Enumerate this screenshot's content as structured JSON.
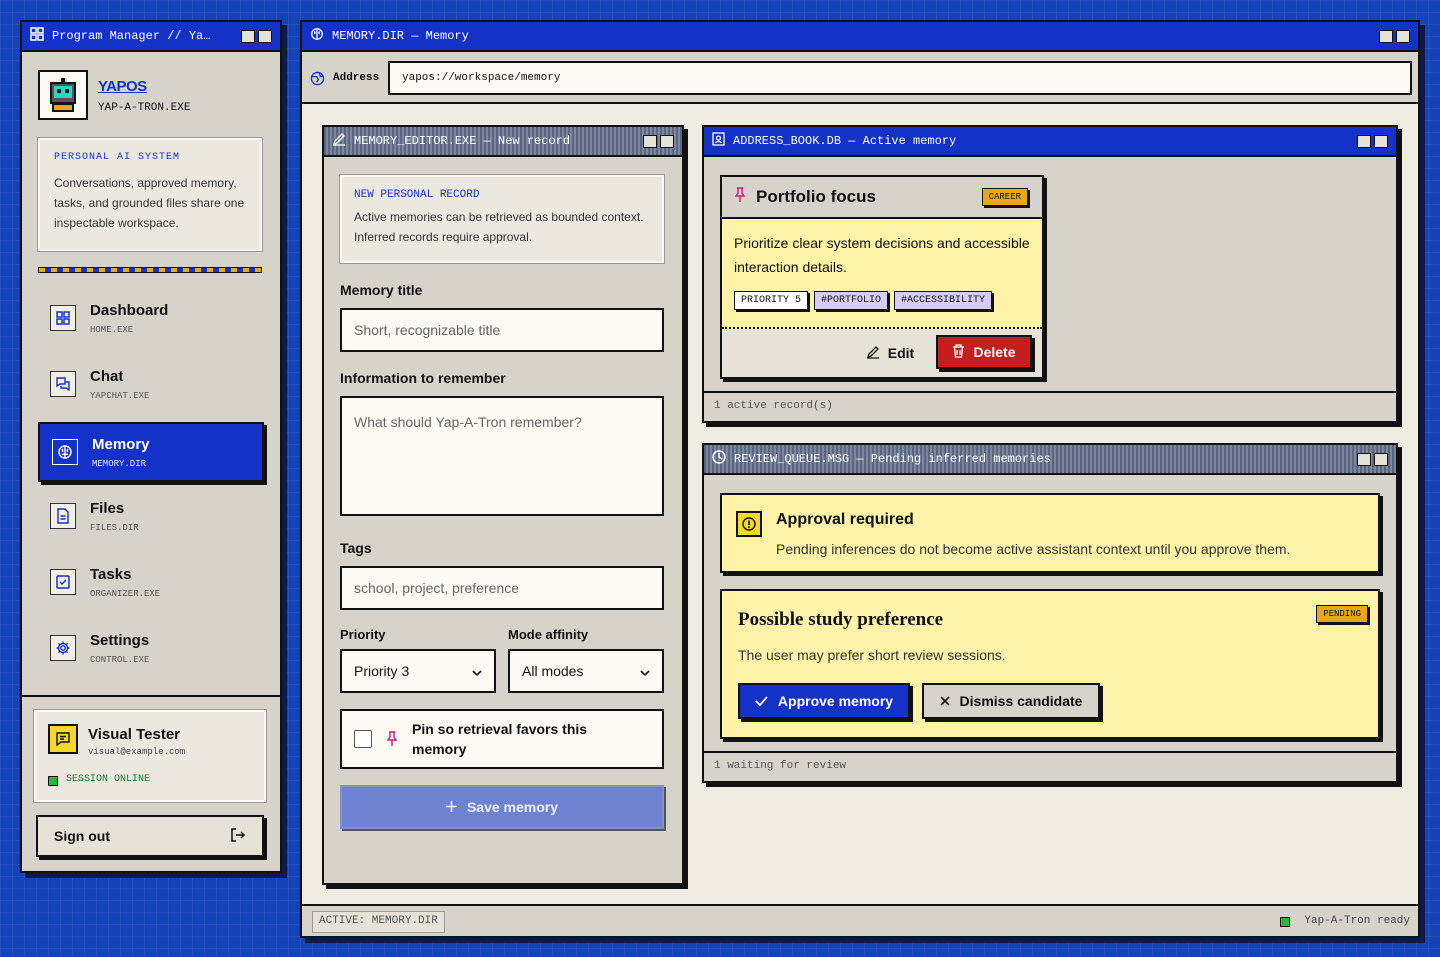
{
  "sidebar": {
    "title": "Program Manager // Ya…",
    "app_name": "YAPOS",
    "app_exe": "YAP-A-TRON.EXE",
    "intro": {
      "heading": "PERSONAL AI SYSTEM",
      "text": "Conversations, approved memory, tasks, and grounded files share one inspectable workspace."
    },
    "nav": [
      {
        "label": "Dashboard",
        "sub": "HOME.EXE"
      },
      {
        "label": "Chat",
        "sub": "YAPCHAT.EXE"
      },
      {
        "label": "Memory",
        "sub": "MEMORY.DIR"
      },
      {
        "label": "Files",
        "sub": "FILES.DIR"
      },
      {
        "label": "Tasks",
        "sub": "ORGANIZER.EXE"
      },
      {
        "label": "Settings",
        "sub": "CONTROL.EXE"
      }
    ],
    "user": {
      "name": "Visual Tester",
      "email": "visual@example.com",
      "status": "SESSION ONLINE"
    },
    "sign_out": "Sign out"
  },
  "main": {
    "title": "MEMORY.DIR — Memory",
    "address_label": "Address",
    "address_value": "yapos://workspace/memory",
    "status_left": "ACTIVE: MEMORY.DIR",
    "status_right": "Yap-A-Tron ready"
  },
  "editor": {
    "title": "MEMORY_EDITOR.EXE — New record",
    "info_heading": "NEW PERSONAL RECORD",
    "info_text": "Active memories can be retrieved as bounded context. Inferred records require approval.",
    "title_label": "Memory title",
    "title_placeholder": "Short, recognizable title",
    "info_label": "Information to remember",
    "info_placeholder": "What should Yap-A-Tron remember?",
    "tags_label": "Tags",
    "tags_placeholder": "school, project, preference",
    "priority_label": "Priority",
    "priority_value": "Priority 3",
    "mode_label": "Mode affinity",
    "mode_value": "All modes",
    "pin_label": "Pin so retrieval favors this memory",
    "save_label": "Save memory"
  },
  "address_book": {
    "title": "ADDRESS_BOOK.DB — Active memory",
    "card": {
      "title": "Portfolio focus",
      "badge": "CAREER",
      "text": "Prioritize clear system decisions and accessible interaction details.",
      "tags": [
        "PRIORITY 5",
        "#PORTFOLIO",
        "#ACCESSIBILITY"
      ],
      "edit": "Edit",
      "delete": "Delete"
    },
    "footer": "1 active record(s)"
  },
  "review": {
    "title": "REVIEW_QUEUE.MSG — Pending inferred memories",
    "notice_title": "Approval required",
    "notice_text": "Pending inferences do not become active assistant context until you approve them.",
    "card": {
      "title": "Possible study preference",
      "badge": "PENDING",
      "text": "The user may prefer short review sessions.",
      "approve": "Approve memory",
      "dismiss": "Dismiss candidate"
    },
    "footer": "1 waiting for review"
  },
  "colors": {
    "accent": "#1432c8",
    "danger": "#c41e1e",
    "note": "#fdf3a8",
    "badge": "#e6a817",
    "online": "#2db43c"
  }
}
